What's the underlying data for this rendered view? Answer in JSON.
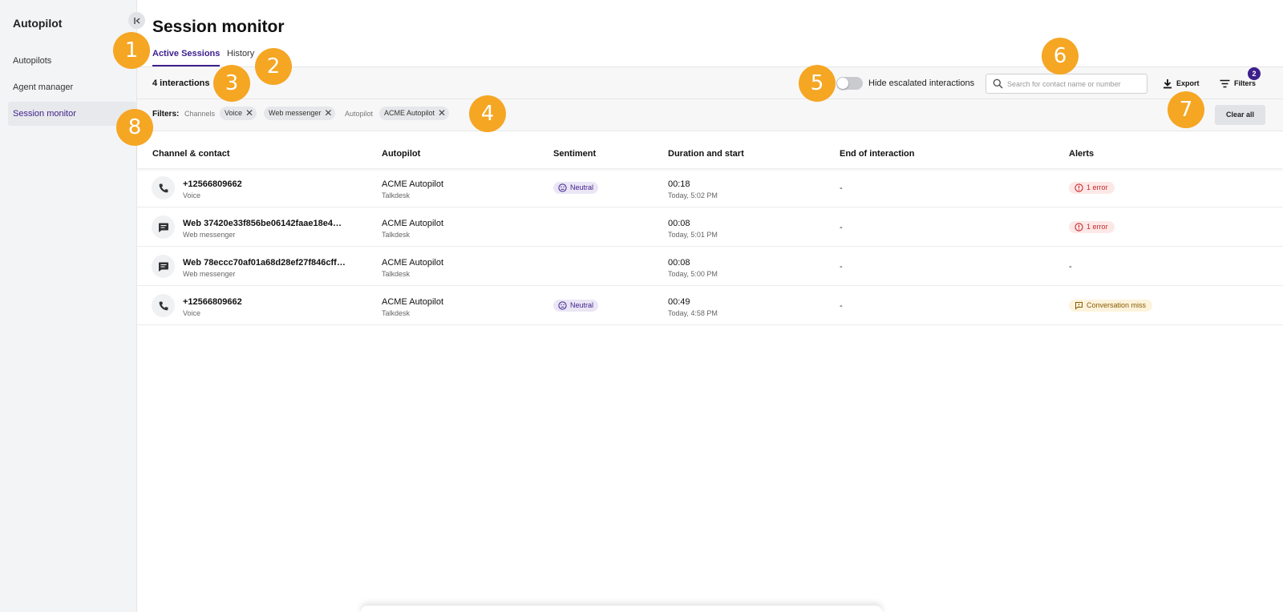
{
  "sidebar": {
    "title": "Autopilot",
    "items": [
      {
        "label": "Autopilots",
        "active": false
      },
      {
        "label": "Agent manager",
        "active": false
      },
      {
        "label": "Session monitor",
        "active": true
      }
    ]
  },
  "page": {
    "title": "Session monitor"
  },
  "tabs": [
    {
      "label": "Active Sessions",
      "active": true
    },
    {
      "label": "History",
      "active": false
    }
  ],
  "toolbar": {
    "count": "4 interactions",
    "toggle_label": "Hide escalated interactions",
    "toggle_on": false,
    "search_placeholder": "Search for contact name or number",
    "export_label": "Export",
    "filters_label": "Filters",
    "filters_count": "2"
  },
  "filters": {
    "label": "Filters:",
    "channels_label": "Channels",
    "channels": [
      "Voice",
      "Web messenger"
    ],
    "autopilot_label": "Autopilot",
    "autopilots": [
      "ACME Autopilot"
    ],
    "clear_label": "Clear all"
  },
  "table": {
    "columns": [
      "Channel & contact",
      "Autopilot",
      "Sentiment",
      "Duration and start",
      "End of interaction",
      "Alerts"
    ],
    "rows": [
      {
        "channel_icon": "phone-icon",
        "contact": "+12566809662",
        "channel": "Voice",
        "autopilot": "ACME Autopilot",
        "company": "Talkdesk",
        "sentiment": "Neutral",
        "duration": "00:18",
        "start": "Today, 5:02 PM",
        "end": "-",
        "alert": "1 error",
        "alert_type": "error"
      },
      {
        "channel_icon": "chat-icon",
        "contact": "Web 37420e33f856be06142faae18e4…",
        "channel": "Web messenger",
        "autopilot": "ACME Autopilot",
        "company": "Talkdesk",
        "sentiment": "",
        "duration": "00:08",
        "start": "Today, 5:01 PM",
        "end": "-",
        "alert": "1 error",
        "alert_type": "error"
      },
      {
        "channel_icon": "chat-icon",
        "contact": "Web 78eccc70af01a68d28ef27f846cff…",
        "channel": "Web messenger",
        "autopilot": "ACME Autopilot",
        "company": "Talkdesk",
        "sentiment": "",
        "duration": "00:08",
        "start": "Today, 5:00 PM",
        "end": "-",
        "alert": "-",
        "alert_type": "none"
      },
      {
        "channel_icon": "phone-icon",
        "contact": "+12566809662",
        "channel": "Voice",
        "autopilot": "ACME Autopilot",
        "company": "Talkdesk",
        "sentiment": "Neutral",
        "duration": "00:49",
        "start": "Today, 4:58 PM",
        "end": "-",
        "alert": "Conversation miss",
        "alert_type": "miss"
      }
    ]
  },
  "callouts": [
    "1",
    "2",
    "3",
    "4",
    "5",
    "6",
    "7",
    "8"
  ],
  "colors": {
    "accent": "#3d1f8c",
    "callout": "#f5a623",
    "error": "#c62828",
    "warning": "#8a5a00"
  }
}
